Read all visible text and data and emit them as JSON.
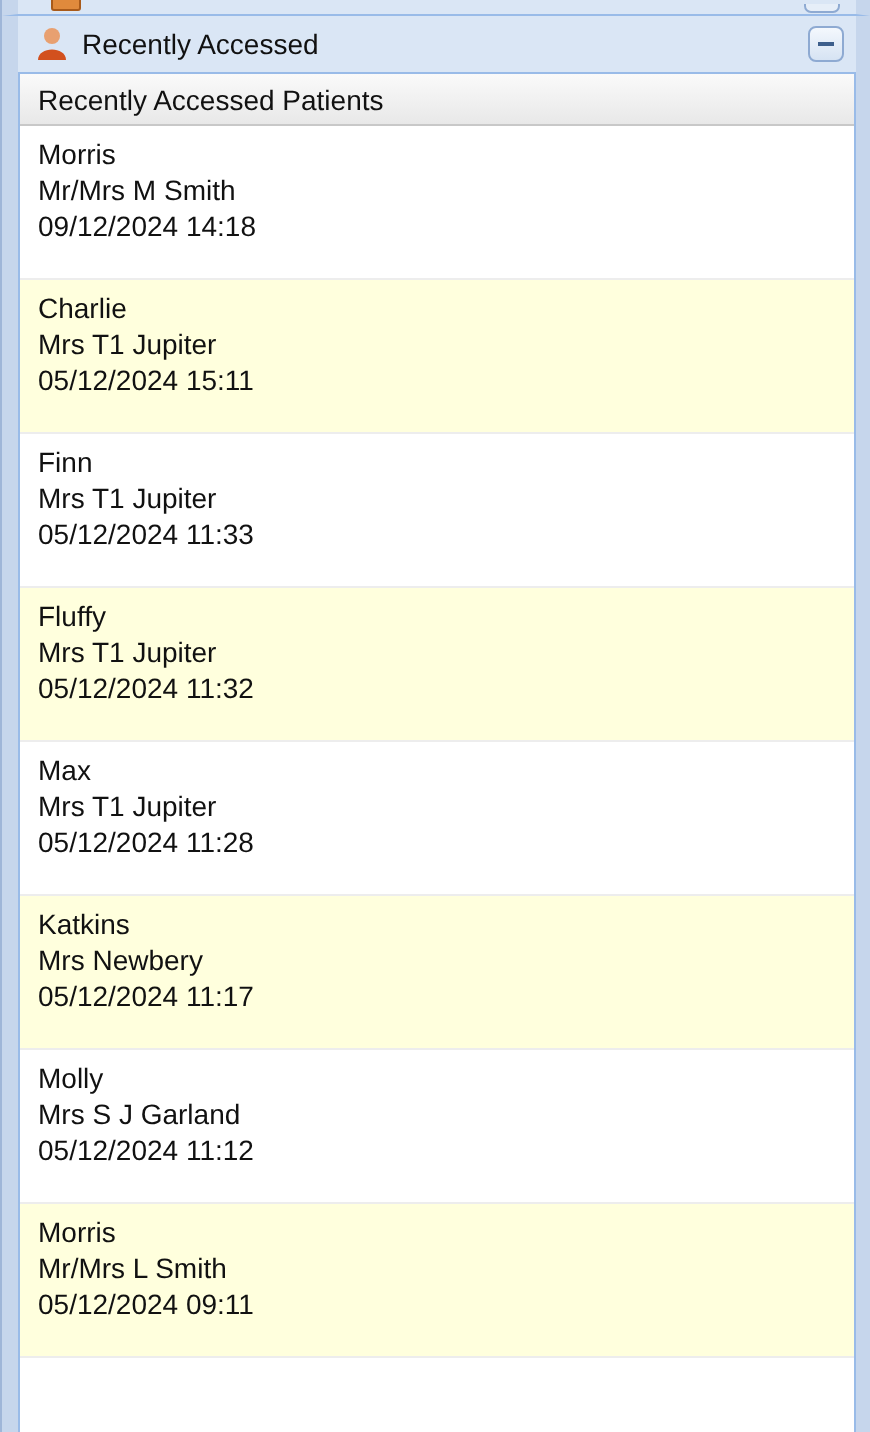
{
  "panel": {
    "title": "Recently Accessed",
    "expanded": true
  },
  "grid": {
    "heading": "Recently Accessed Patients",
    "rows": [
      {
        "pet": "Morris",
        "owner": "Mr/Mrs M Smith",
        "accessed": "09/12/2024 14:18"
      },
      {
        "pet": "Charlie",
        "owner": "Mrs T1 Jupiter",
        "accessed": "05/12/2024 15:11"
      },
      {
        "pet": "Finn",
        "owner": "Mrs T1 Jupiter",
        "accessed": "05/12/2024 11:33"
      },
      {
        "pet": "Fluffy",
        "owner": "Mrs T1 Jupiter",
        "accessed": "05/12/2024 11:32"
      },
      {
        "pet": "Max",
        "owner": "Mrs T1 Jupiter",
        "accessed": "05/12/2024 11:28"
      },
      {
        "pet": "Katkins",
        "owner": "Mrs Newbery",
        "accessed": "05/12/2024 11:17"
      },
      {
        "pet": "Molly",
        "owner": "Mrs S J Garland",
        "accessed": "05/12/2024 11:12"
      },
      {
        "pet": "Morris",
        "owner": "Mr/Mrs L Smith",
        "accessed": "05/12/2024 09:11"
      }
    ]
  }
}
